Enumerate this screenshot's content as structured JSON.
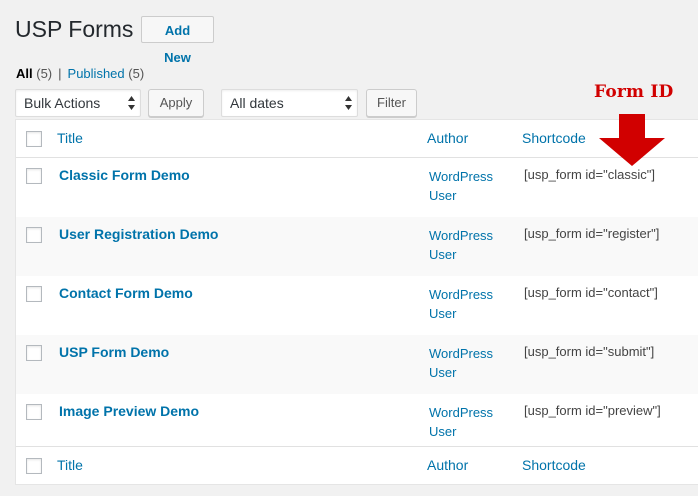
{
  "header": {
    "title": "USP Forms",
    "add_new": "Add New"
  },
  "views": [
    {
      "label": "All",
      "count": "(5)"
    },
    {
      "label": "Published",
      "count": "(5)"
    }
  ],
  "views_separator": "|",
  "toolbar": {
    "bulk_actions": "Bulk Actions",
    "apply": "Apply",
    "dates": "All dates",
    "filter": "Filter"
  },
  "columns": {
    "title": "Title",
    "author": "Author",
    "shortcode": "Shortcode"
  },
  "rows": [
    {
      "title": "Classic Form Demo",
      "author_line1": "WordPress",
      "author_line2": "User",
      "shortcode": "[usp_form id=\"classic\"]"
    },
    {
      "title": "User Registration Demo",
      "author_line1": "WordPress",
      "author_line2": "User",
      "shortcode": "[usp_form id=\"register\"]"
    },
    {
      "title": "Contact Form Demo",
      "author_line1": "WordPress",
      "author_line2": "User",
      "shortcode": "[usp_form id=\"contact\"]"
    },
    {
      "title": "USP Form Demo",
      "author_line1": "WordPress",
      "author_line2": "User",
      "shortcode": "[usp_form id=\"submit\"]"
    },
    {
      "title": "Image Preview Demo",
      "author_line1": "WordPress",
      "author_line2": "User",
      "shortcode": "[usp_form id=\"preview\"]"
    }
  ],
  "annotation": {
    "label": "Form ID",
    "color": "#d10000",
    "icon": "down-arrow-icon"
  },
  "colors": {
    "link": "#0073aa",
    "background": "#f1f1f1"
  }
}
